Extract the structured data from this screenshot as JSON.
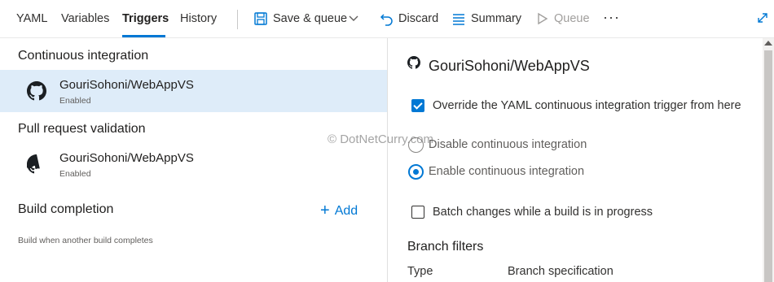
{
  "toolbar": {
    "tabs": [
      {
        "label": "YAML"
      },
      {
        "label": "Variables"
      },
      {
        "label": "Triggers"
      },
      {
        "label": "History"
      }
    ],
    "active_tab": "Triggers",
    "save_queue_label": "Save & queue",
    "discard_label": "Discard",
    "summary_label": "Summary",
    "queue_label": "Queue",
    "more_label": "···"
  },
  "left": {
    "ci_title": "Continuous integration",
    "ci_repo": {
      "name": "GouriSohoni/WebAppVS",
      "status": "Enabled"
    },
    "pr_title": "Pull request validation",
    "pr_repo": {
      "name": "GouriSohoni/WebAppVS",
      "status": "Enabled"
    },
    "build_title": "Build completion",
    "add_label": "Add",
    "build_subtitle": "Build when another build completes"
  },
  "right": {
    "repo_title": "GouriSohoni/WebAppVS",
    "override_label": "Override the YAML continuous integration trigger from here",
    "override_checked": true,
    "disable_ci_label": "Disable continuous integration",
    "enable_ci_label": "Enable continuous integration",
    "selected_option": "enable",
    "batch_label": "Batch changes while a build is in progress",
    "batch_checked": false,
    "branch_filters_title": "Branch filters",
    "col_type": "Type",
    "col_branch_spec": "Branch specification"
  },
  "watermark": "© DotNetCurry.com",
  "colors": {
    "accent": "#0078d4",
    "selected_row": "#deecf9"
  },
  "icons": [
    "save-icon",
    "chevron-down-icon",
    "undo-icon",
    "list-icon",
    "play-icon",
    "more-icon",
    "expand-icon",
    "github-icon",
    "plus-icon"
  ]
}
